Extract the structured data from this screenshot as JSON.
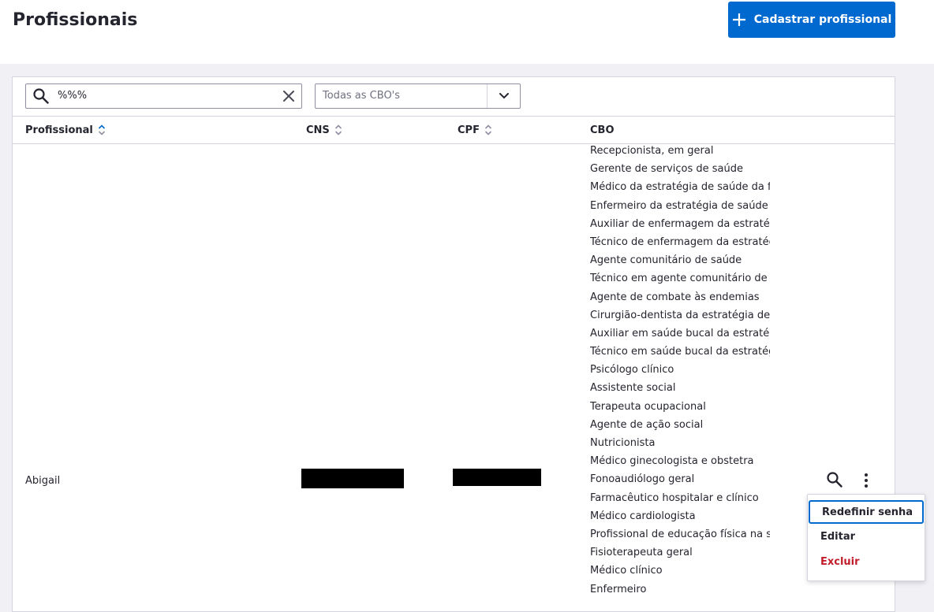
{
  "header": {
    "title": "Profissionais",
    "register_button": "Cadastrar profissional"
  },
  "filters": {
    "search_value": "%%%",
    "cbo_select": "Todas as CBO's"
  },
  "table": {
    "columns": {
      "profissional": "Profissional",
      "cns": "CNS",
      "cpf": "CPF",
      "cbo": "CBO"
    },
    "rows": [
      {
        "name": "Abigail",
        "cbos": [
          "Recepcionista, em geral",
          "Gerente de serviços de saúde",
          "Médico da estratégia de saúde da famíl",
          "Enfermeiro da estratégia de saúde da fa",
          "Auxiliar de enfermagem da estratégia d",
          "Técnico de enfermagem da estratégia d",
          "Agente comunitário de saúde",
          "Técnico em agente comunitário de saúd",
          "Agente de combate às endemias",
          "Cirurgião-dentista da estratégia de saú",
          "Auxiliar em saúde bucal da estratégia d",
          "Técnico em saúde bucal da estratégia d",
          "Psicólogo clínico",
          "Assistente social",
          "Terapeuta ocupacional",
          "Agente de ação social",
          "Nutricionista",
          "Médico ginecologista e obstetra",
          "Fonoaudiólogo geral",
          "Farmacêutico hospitalar e clínico",
          "Médico cardiologista",
          "Profissional de educação física na saúd",
          "Fisioterapeuta geral",
          "Médico clínico",
          "Enfermeiro"
        ]
      }
    ]
  },
  "row_menu": {
    "reset_password": "Redefinir senha",
    "edit": "Editar",
    "delete": "Excluir"
  },
  "colors": {
    "primary": "#0069d0",
    "danger": "#c11d2a",
    "text": "#24252e",
    "border": "#d3d4dd"
  }
}
